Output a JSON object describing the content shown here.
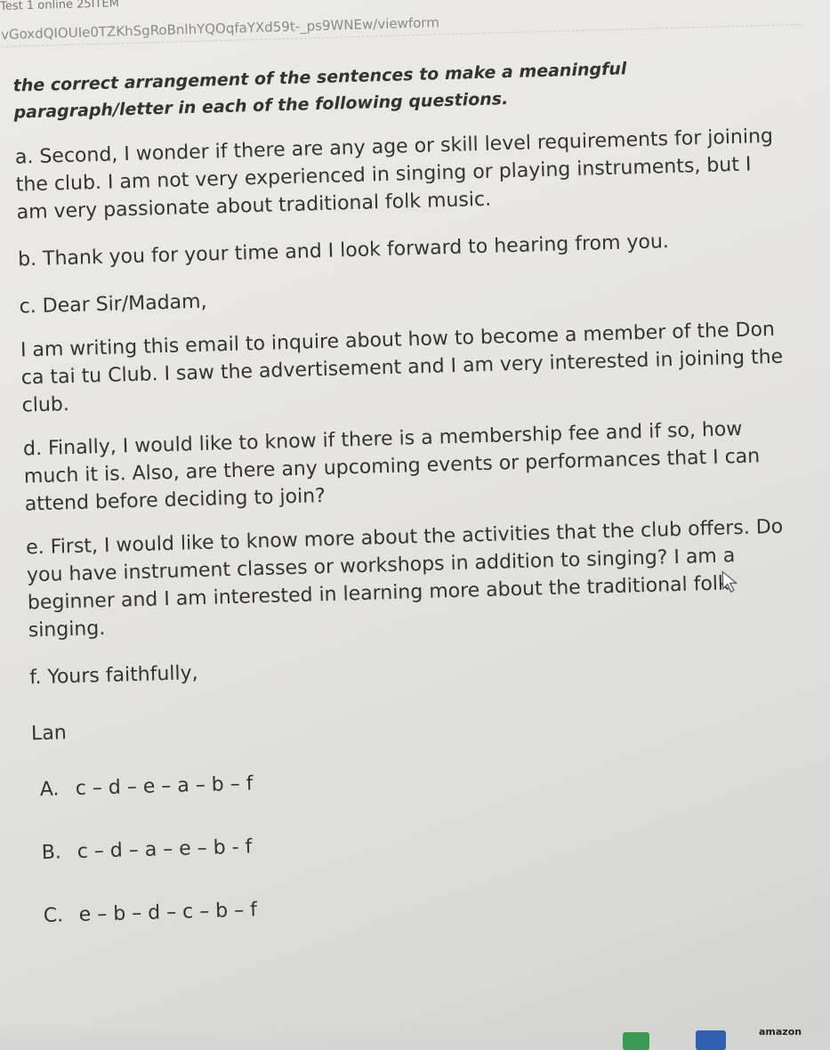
{
  "browser": {
    "tab_title": "Test 1 online 25ITEM",
    "url": "vGoxdQIOUIe0TZKhSgRoBnlhYQOqfaYXd59t-_ps9WNEw/viewform"
  },
  "question": {
    "instruction_line1": "the correct arrangement of the sentences to make a meaningful",
    "instruction_line2": "paragraph/letter in each of the following questions.",
    "sentences": [
      "a. Second, I wonder if there are any age or skill level requirements for joining the club. I am not very experienced in singing or playing instruments, but I am very passionate about traditional folk music.",
      "b. Thank you for your time and I look forward to hearing from you.",
      "c. Dear Sir/Madam,",
      "I am writing this email to inquire about how to become a member of the Don ca tai tu Club. I saw the advertisement and I am very interested in joining the club.",
      "d. Finally, I would like to know if there is a membership fee and if so, how much it is. Also, are there any upcoming events or performances that I can attend before deciding to join?",
      "e. First, I would like to know more about the activities that the club offers. Do you have instrument classes or workshops in addition to singing? I am a beginner and I am interested in learning more about the traditional folk singing.",
      "f. Yours faithfully,",
      "Lan"
    ]
  },
  "options": [
    {
      "key": "A.",
      "value": "c – d – e – a – b – f"
    },
    {
      "key": "B.",
      "value": "c – d – a – e – b - f"
    },
    {
      "key": "C.",
      "value": "e – b – d – c – b – f"
    }
  ],
  "taskbar": {
    "label": "amazon"
  }
}
